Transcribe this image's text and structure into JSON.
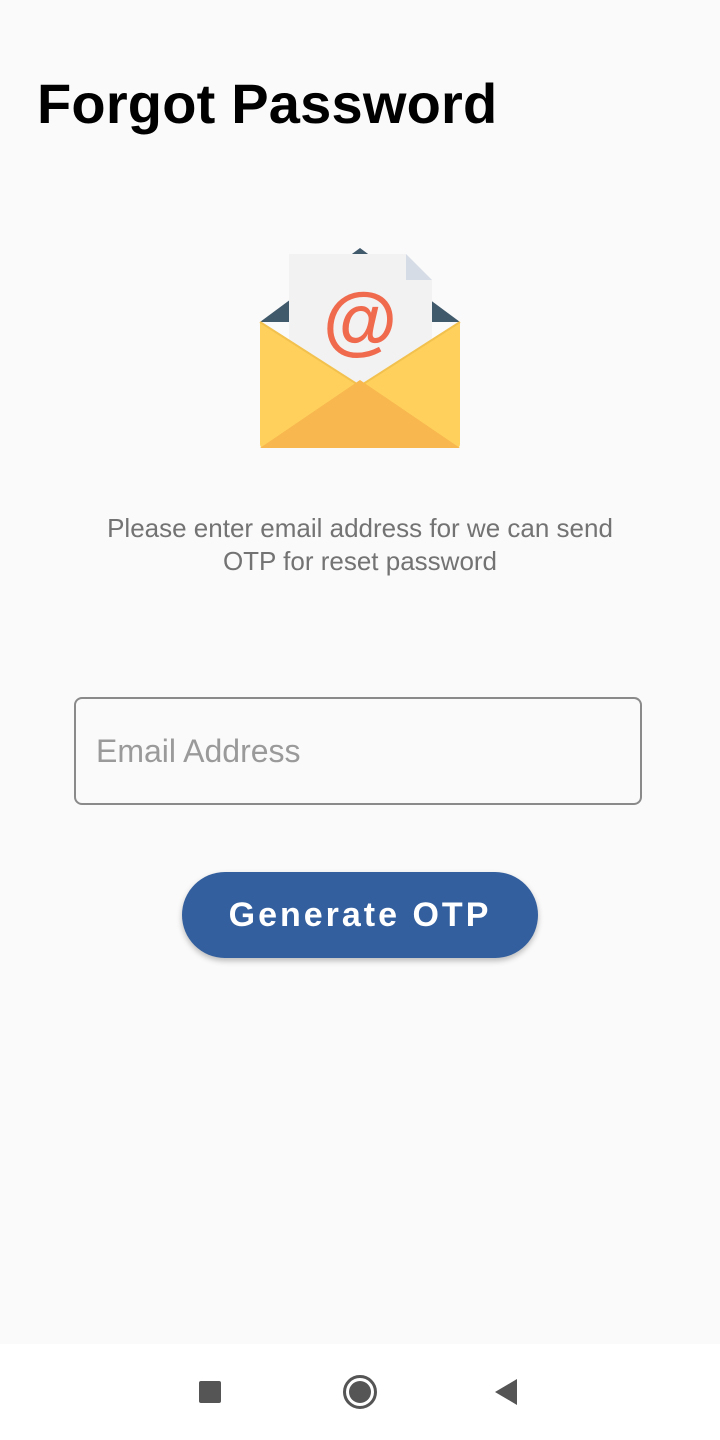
{
  "page": {
    "title": "Forgot Password",
    "description": "Please enter email address for we can send OTP for reset password"
  },
  "illustration": {
    "icon": "envelope-at-icon",
    "glyph": "@"
  },
  "form": {
    "email_placeholder": "Email Address",
    "email_value": ""
  },
  "actions": {
    "generate_label": "Generate OTP"
  },
  "nav_bar": {
    "recents_icon": "square-icon",
    "home_icon": "circle-icon",
    "back_icon": "triangle-back-icon"
  },
  "colors": {
    "background": "#fafafa",
    "button": "#335f9e",
    "envelope_yellow": "#ffd15c",
    "envelope_front": "#f8b74f",
    "envelope_back": "#40596b",
    "at_sign": "#f06a4e"
  }
}
